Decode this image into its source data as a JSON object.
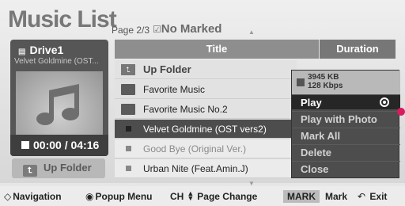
{
  "header": {
    "title": "Music List",
    "page_info": "Page 2/3",
    "marked_info": "No Marked"
  },
  "device": {
    "drive_name": "Drive1",
    "now_playing": "Velvet Goldmine (OST...",
    "playback_time": "00:00 / 04:16",
    "up_folder_button": "Up Folder"
  },
  "table": {
    "columns": [
      "Title",
      "Duration"
    ],
    "rows": [
      {
        "type": "up",
        "label": "Up Folder"
      },
      {
        "type": "folder",
        "label": "Favorite Music"
      },
      {
        "type": "folder",
        "label": "Favorite Music No.2"
      },
      {
        "type": "file",
        "label": "Velvet Goldmine (OST vers2)",
        "selected": true
      },
      {
        "type": "file",
        "label": "Good Bye (Original Ver.)",
        "dim": true
      },
      {
        "type": "file",
        "label": "Urban Nite (Feat.Amin.J)"
      }
    ]
  },
  "popup": {
    "file_size": "3945 KB",
    "bitrate": "128 Kbps",
    "items": [
      "Play",
      "Play with Photo",
      "Mark All",
      "Delete",
      "Close"
    ],
    "active_item": "Play"
  },
  "footer": {
    "navigation": "Navigation",
    "popup_menu": "Popup Menu",
    "ch_key": "CH",
    "page_change": "Page Change",
    "mark_key": "MARK",
    "mark": "Mark",
    "exit": "Exit"
  },
  "icons": [
    "drive-icon",
    "music-note-icon",
    "stop-icon",
    "up-folder-icon",
    "folder-icon",
    "file-icon",
    "radio-selected-icon",
    "navigation-arrows-icon",
    "ok-button-icon",
    "ch-arrows-icon",
    "exit-icon"
  ],
  "colors": {
    "selection": "#4d4d4d",
    "header": "#8e8e8e",
    "accent_dot": "#d81b60"
  }
}
